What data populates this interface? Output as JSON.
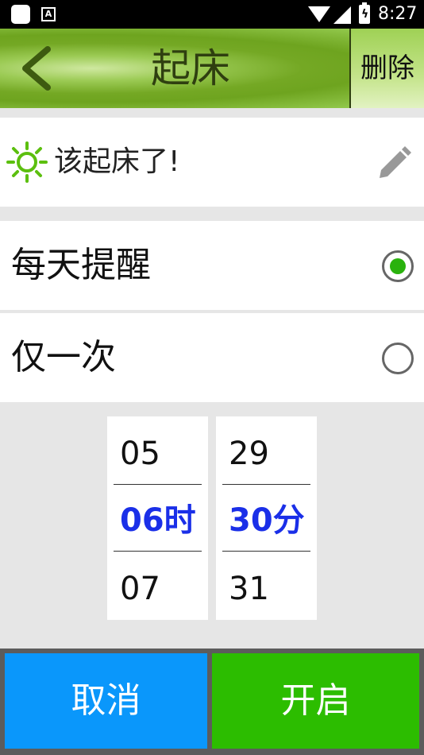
{
  "status_bar": {
    "time": "8:27",
    "notification_icon": "a-icon"
  },
  "header": {
    "title": "起床",
    "delete_label": "删除",
    "back_icon": "chevron-left-icon"
  },
  "note": {
    "text": "该起床了!",
    "icon": "sun-icon",
    "edit_icon": "pencil-icon"
  },
  "repeat_options": [
    {
      "label": "每天提醒",
      "selected": true
    },
    {
      "label": "仅一次",
      "selected": false
    }
  ],
  "time_picker": {
    "hour": {
      "prev": "05",
      "current": "06时",
      "next": "07"
    },
    "minute": {
      "prev": "29",
      "current": "30分",
      "next": "31"
    },
    "selected_color": "#1a2fe8"
  },
  "actions": {
    "cancel_label": "取消",
    "cancel_color": "#0a97fb",
    "confirm_label": "开启",
    "confirm_color": "#2cbd00"
  }
}
